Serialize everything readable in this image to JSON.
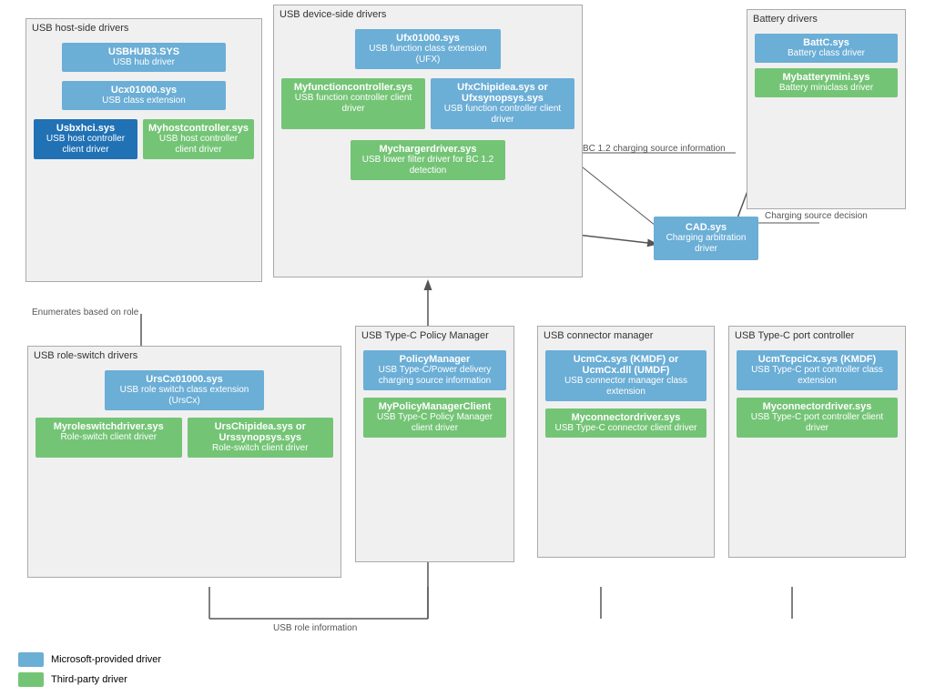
{
  "legend": {
    "microsoft_label": "Microsoft-provided driver",
    "thirdparty_label": "Third-party driver"
  },
  "groups": {
    "host_side": {
      "label": "USB host-side drivers",
      "boxes": [
        {
          "name": "USBHUB3.SYS",
          "desc": "USB hub driver",
          "color": "blue"
        },
        {
          "name": "Ucx01000.sys",
          "desc": "USB class extension",
          "color": "blue"
        },
        {
          "name": "Usbxhci.sys",
          "desc": "USB host controller client driver",
          "color": "dark-blue"
        },
        {
          "name": "Myhostcontroller.sys",
          "desc": "USB host controller client driver",
          "color": "green"
        }
      ]
    },
    "device_side": {
      "label": "USB device-side drivers",
      "boxes": [
        {
          "name": "Ufx01000.sys",
          "desc": "USB function class extension (UFX)",
          "color": "blue"
        },
        {
          "name": "Myfunctioncontroller.sys",
          "desc": "USB function controller client driver",
          "color": "green"
        },
        {
          "name": "UfxChipidea.sys or Ufxsynopsys.sys",
          "desc": "USB function controller client driver",
          "color": "blue"
        },
        {
          "name": "Mychargerdriver.sys",
          "desc": "USB lower filter driver for BC 1.2 detection",
          "color": "green"
        }
      ]
    },
    "battery": {
      "label": "Battery drivers",
      "boxes": [
        {
          "name": "BattC.sys",
          "desc": "Battery class driver",
          "color": "blue"
        },
        {
          "name": "Mybatterymini.sys",
          "desc": "Battery miniclass driver",
          "color": "green"
        }
      ]
    },
    "cad": {
      "name": "CAD.sys",
      "desc": "Charging arbitration driver",
      "color": "blue"
    },
    "policy_manager": {
      "label": "USB Type-C Policy Manager",
      "boxes": [
        {
          "name": "PolicyManager",
          "desc": "USB Type-C/Power delivery charging source information",
          "color": "blue"
        },
        {
          "name": "MyPolicyManagerClient",
          "desc": "USB Type-C Policy Manager client driver",
          "color": "green"
        }
      ]
    },
    "connector_manager": {
      "label": "USB connector manager",
      "boxes": [
        {
          "name": "UcmCx.sys (KMDF) or UcmCx.dll (UMDF)",
          "desc": "USB connector manager class extension",
          "color": "blue"
        },
        {
          "name": "Myconnectordriver.sys",
          "desc": "USB Type-C connector client driver",
          "color": "green"
        }
      ]
    },
    "port_controller": {
      "label": "USB Type-C port controller",
      "boxes": [
        {
          "name": "UcmTcpciCx.sys (KMDF)",
          "desc": "USB Type-C port controller class extension",
          "color": "blue"
        },
        {
          "name": "Myconnectordriver.sys",
          "desc": "USB Type-C port controller client driver",
          "color": "green"
        }
      ]
    },
    "role_switch": {
      "label": "USB role-switch drivers",
      "boxes": [
        {
          "name": "UrsCx01000.sys",
          "desc": "USB role switch class extension (UrsCx)",
          "color": "blue"
        },
        {
          "name": "Myroleswitchdriver.sys",
          "desc": "Role-switch client driver",
          "color": "green"
        },
        {
          "name": "UrsChipidea.sys or Urssynopsys.sys",
          "desc": "Role-switch client driver",
          "color": "green"
        }
      ]
    }
  },
  "line_labels": {
    "bc_info": "BC 1.2 charging source information",
    "charging_decision": "Charging source decision",
    "enumerates": "Enumerates based on role",
    "role_info": "USB role information"
  }
}
